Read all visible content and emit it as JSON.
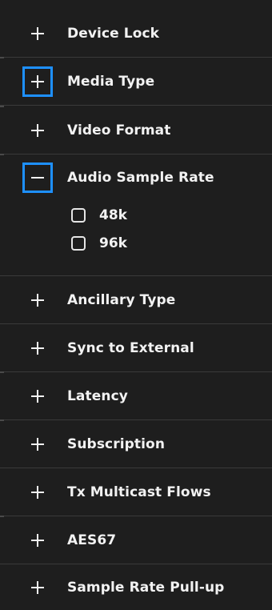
{
  "filters": {
    "items": [
      {
        "label": "Device Lock",
        "state": "collapsed"
      },
      {
        "label": "Media Type",
        "state": "collapsed",
        "focused": true
      },
      {
        "label": "Video Format",
        "state": "collapsed"
      },
      {
        "label": "Audio Sample Rate",
        "state": "expanded",
        "focused": true,
        "options": [
          {
            "label": "48k",
            "checked": false
          },
          {
            "label": "96k",
            "checked": false
          }
        ]
      },
      {
        "label": "Ancillary Type",
        "state": "collapsed"
      },
      {
        "label": "Sync to External",
        "state": "collapsed"
      },
      {
        "label": "Latency",
        "state": "collapsed"
      },
      {
        "label": "Subscription",
        "state": "collapsed"
      },
      {
        "label": "Tx Multicast Flows",
        "state": "collapsed"
      },
      {
        "label": "AES67",
        "state": "collapsed"
      },
      {
        "label": "Sample Rate Pull-up",
        "state": "collapsed"
      }
    ]
  },
  "colors": {
    "background": "#1e1e1e",
    "divider": "#3a3a3a",
    "focus_ring": "#1e90ff",
    "text": "#f2f2f2"
  },
  "icons": {
    "expand": "plus-icon",
    "collapse": "minus-icon",
    "option": "checkbox"
  }
}
